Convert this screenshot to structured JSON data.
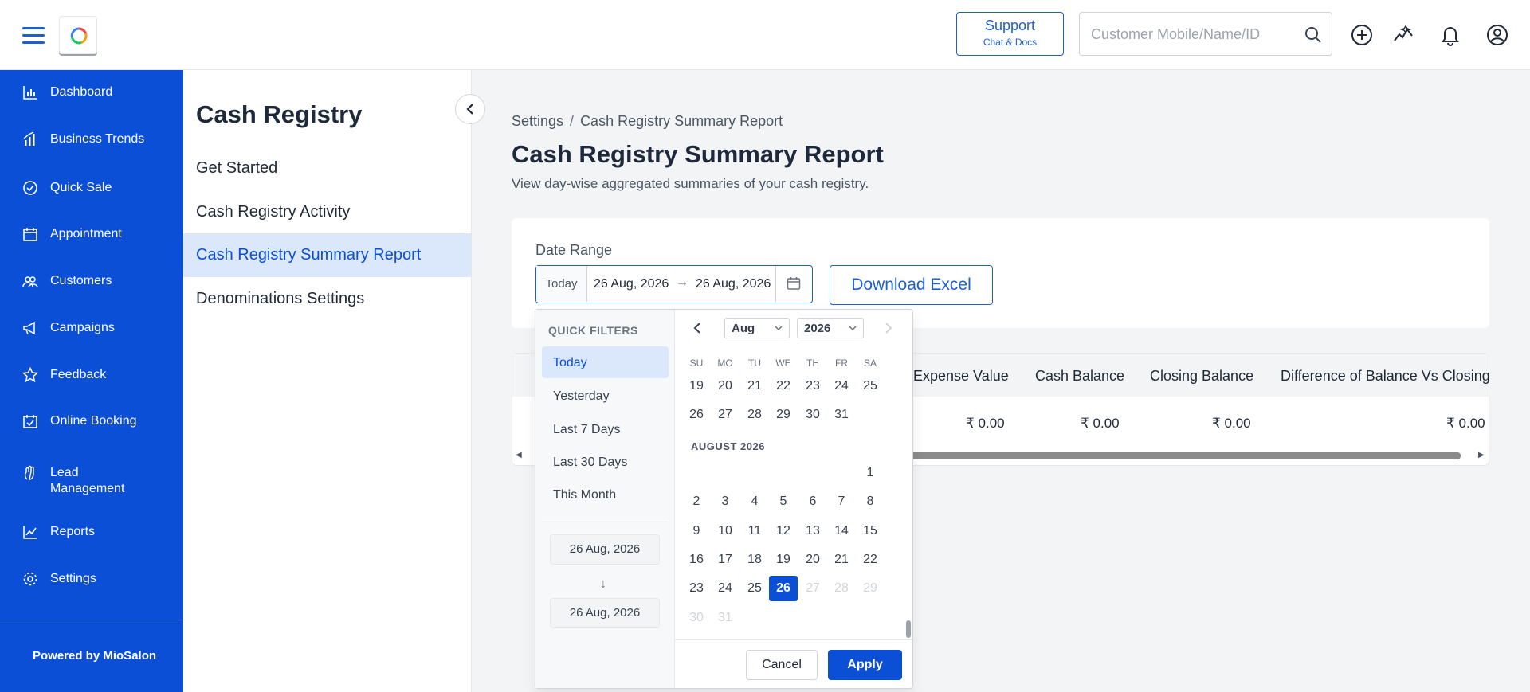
{
  "topbar": {
    "support_title": "Support",
    "support_sub": "Chat & Docs",
    "search_placeholder": "Customer Mobile/Name/ID",
    "brand_color": "#0b4fd6"
  },
  "leftnav": {
    "items": [
      {
        "label": "Dashboard",
        "icon": "dashboard-icon"
      },
      {
        "label": "Business Trends",
        "icon": "bar-chart-icon"
      },
      {
        "label": "Quick Sale",
        "icon": "check-circle-icon"
      },
      {
        "label": "Appointment",
        "icon": "calendar-icon"
      },
      {
        "label": "Customers",
        "icon": "users-icon"
      },
      {
        "label": "Campaigns",
        "icon": "megaphone-icon"
      },
      {
        "label": "Feedback",
        "icon": "star-icon"
      },
      {
        "label": "Online Booking",
        "icon": "calendar-check-icon"
      },
      {
        "label": "Lead Management",
        "icon": "hand-icon"
      },
      {
        "label": "Reports",
        "icon": "trend-icon"
      },
      {
        "label": "Settings",
        "icon": "gear-icon"
      }
    ],
    "footer": "Powered by MioSalon"
  },
  "subnav": {
    "title": "Cash Registry",
    "items": [
      {
        "label": "Get Started"
      },
      {
        "label": "Cash Registry Activity"
      },
      {
        "label": "Cash Registry Summary Report"
      },
      {
        "label": "Denominations Settings"
      }
    ]
  },
  "main": {
    "breadcrumb": [
      "Settings",
      "Cash Registry Summary Report"
    ],
    "title": "Cash Registry Summary Report",
    "subtitle": "View day-wise aggregated summaries of your cash registry.",
    "date_label": "Date Range",
    "date_tag": "Today",
    "date_from": "26 Aug, 2026",
    "date_arrow": "→",
    "date_to": "26 Aug, 2026",
    "download_label": "Download Excel"
  },
  "table": {
    "columns": [
      "Expense Value",
      "Cash Balance",
      "Closing Balance",
      "Difference of Balance Vs Closing"
    ],
    "row": [
      "₹ 0.00",
      "₹ 0.00",
      "₹ 0.00",
      "₹ 0.00"
    ]
  },
  "picker": {
    "quick_title": "QUICK FILTERS",
    "quick_filters": [
      "Today",
      "Yesterday",
      "Last 7 Days",
      "Last 30 Days",
      "This Month"
    ],
    "active_filter": "Today",
    "from": "26 Aug, 2026",
    "down_arrow": "↓",
    "to": "26 Aug, 2026",
    "month_select": "Aug",
    "year_select": "2026",
    "weekdays": [
      "SU",
      "MO",
      "TU",
      "WE",
      "TH",
      "FR",
      "SA"
    ],
    "prev_weeks": [
      [
        "19",
        "20",
        "21",
        "22",
        "23",
        "24",
        "25"
      ],
      [
        "26",
        "27",
        "28",
        "29",
        "30",
        "31",
        ""
      ]
    ],
    "month_label": "AUGUST 2026",
    "weeks": [
      [
        "",
        "",
        "",
        "",
        "",
        "",
        "1"
      ],
      [
        "2",
        "3",
        "4",
        "5",
        "6",
        "7",
        "8"
      ],
      [
        "9",
        "10",
        "11",
        "12",
        "13",
        "14",
        "15"
      ],
      [
        "16",
        "17",
        "18",
        "19",
        "20",
        "21",
        "22"
      ],
      [
        "23",
        "24",
        "25",
        "26",
        "27",
        "28",
        "29"
      ],
      [
        "30",
        "31",
        "",
        "",
        "",
        "",
        ""
      ]
    ],
    "selected_day": "26",
    "cancel": "Cancel",
    "apply": "Apply"
  }
}
